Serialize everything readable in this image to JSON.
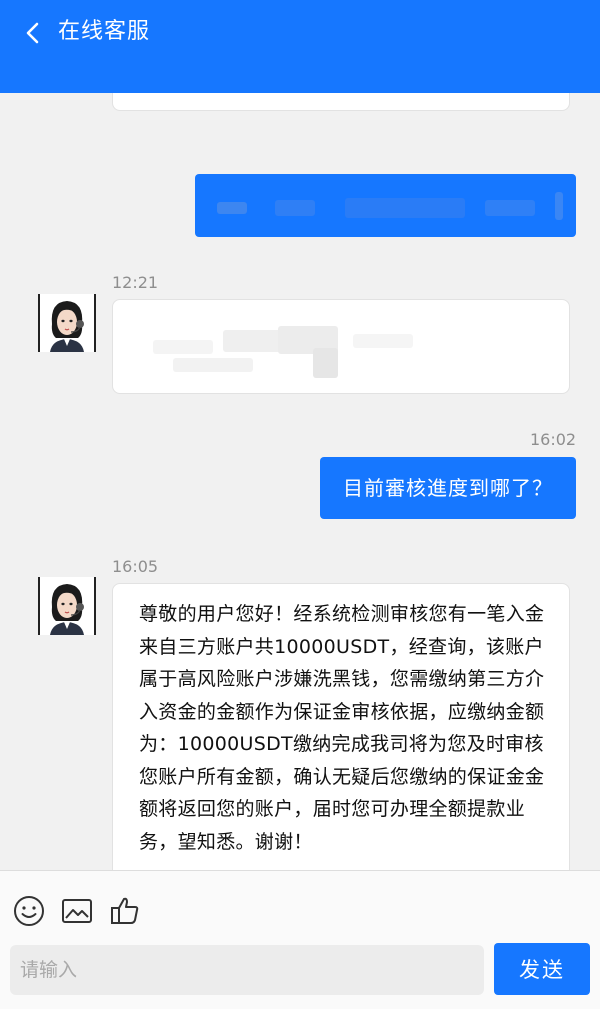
{
  "header": {
    "title": "在线客服",
    "back_icon": "chevron-left-icon"
  },
  "messages": [
    {
      "from": "agent",
      "time": "12:21",
      "text": ""
    },
    {
      "from": "user",
      "time": "16:02",
      "text": "目前審核進度到哪了？"
    },
    {
      "from": "agent",
      "time": "16:05",
      "text": "尊敬的用户您好！经系统检测审核您有一笔入金来自三方账户共10000USDT，经查询，该账户属于高风险账户涉嫌洗黑钱，您需缴纳第三方介入资金的金额作为保证金审核依据，应缴纳金额为：10000USDT缴纳完成我司将为您及时审核您账户所有金额，确认无疑后您缴纳的保证金金额将返回您的账户，届时您可办理全额提款业务，望知悉。谢谢！"
    }
  ],
  "toolbar": {
    "icons": [
      "emoji-icon",
      "image-icon",
      "thumbs-up-icon"
    ]
  },
  "composer": {
    "placeholder": "请输入",
    "value": "",
    "send_label": "发送"
  },
  "colors": {
    "accent": "#1677ff",
    "background": "#f1f1f1",
    "bubble_agent": "#ffffff"
  }
}
